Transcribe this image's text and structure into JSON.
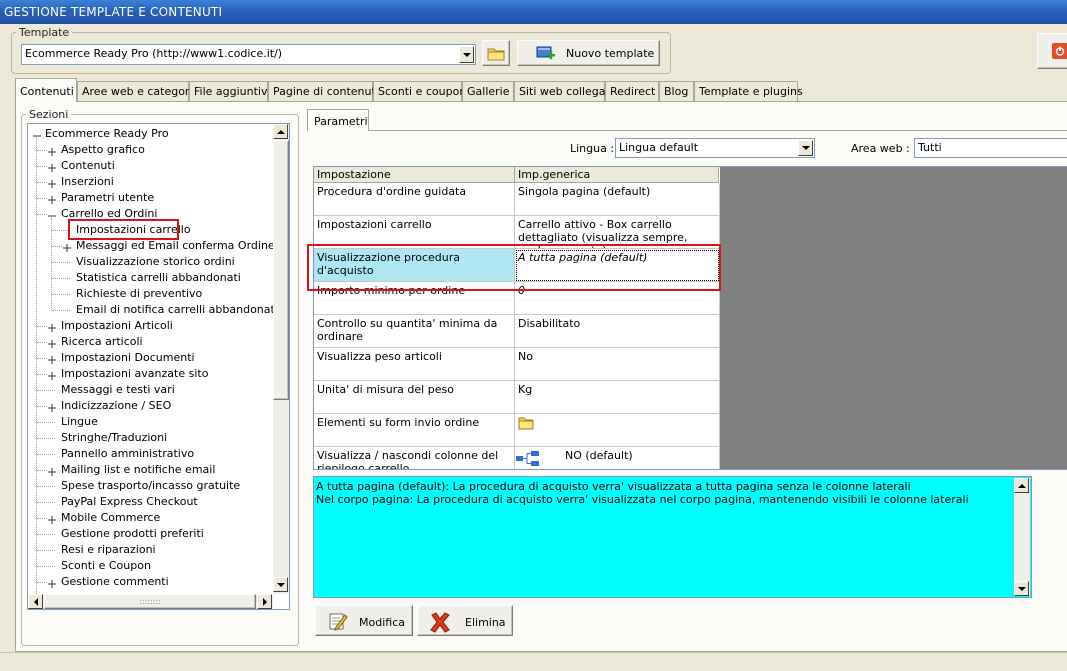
{
  "window": {
    "title": "GESTIONE TEMPLATE E CONTENUTI"
  },
  "template_group": {
    "legend": "Template",
    "selected": "Ecommerce Ready Pro (http://www1.codice.it/)",
    "new_template_label": "Nuovo template"
  },
  "tabs": [
    {
      "label": "Contenuti",
      "active": true
    },
    {
      "label": "Aree web e categorie"
    },
    {
      "label": "File aggiuntivi"
    },
    {
      "label": "Pagine di contenuti"
    },
    {
      "label": "Sconti e coupon"
    },
    {
      "label": "Gallerie"
    },
    {
      "label": "Siti web collegati"
    },
    {
      "label": "Redirect"
    },
    {
      "label": "Blog"
    },
    {
      "label": "Template e plugins"
    }
  ],
  "sections": {
    "legend": "Sezioni",
    "tree": [
      {
        "label": "Ecommerce Ready Pro",
        "level": 0,
        "expander": "minus"
      },
      {
        "label": "Aspetto grafico",
        "level": 1,
        "expander": "plus"
      },
      {
        "label": "Contenuti",
        "level": 1,
        "expander": "plus"
      },
      {
        "label": "Inserzioni",
        "level": 1,
        "expander": "plus"
      },
      {
        "label": "Parametri utente",
        "level": 1,
        "expander": "plus"
      },
      {
        "label": "Carrello ed Ordini",
        "level": 1,
        "expander": "minus"
      },
      {
        "label": "Impostazioni carrello",
        "level": 2,
        "expander": "none",
        "selected": true
      },
      {
        "label": "Messaggi ed Email conferma Ordine",
        "level": 2,
        "expander": "plus"
      },
      {
        "label": "Visualizzazione storico ordini",
        "level": 2,
        "expander": "none"
      },
      {
        "label": "Statistica carrelli abbandonati",
        "level": 2,
        "expander": "none"
      },
      {
        "label": "Richieste di preventivo",
        "level": 2,
        "expander": "none"
      },
      {
        "label": "Email di notifica carrelli abbandonati",
        "level": 2,
        "expander": "none"
      },
      {
        "label": "Impostazioni Articoli",
        "level": 1,
        "expander": "plus"
      },
      {
        "label": "Ricerca articoli",
        "level": 1,
        "expander": "plus"
      },
      {
        "label": "Impostazioni Documenti",
        "level": 1,
        "expander": "plus"
      },
      {
        "label": "Impostazioni avanzate sito",
        "level": 1,
        "expander": "plus"
      },
      {
        "label": "Messaggi e testi vari",
        "level": 1,
        "expander": "none"
      },
      {
        "label": "Indicizzazione / SEO",
        "level": 1,
        "expander": "plus"
      },
      {
        "label": "Lingue",
        "level": 1,
        "expander": "none"
      },
      {
        "label": "Stringhe/Traduzioni",
        "level": 1,
        "expander": "none"
      },
      {
        "label": "Pannello amministrativo",
        "level": 1,
        "expander": "none"
      },
      {
        "label": "Mailing list e notifiche email",
        "level": 1,
        "expander": "plus"
      },
      {
        "label": "Spese trasporto/incasso gratuite",
        "level": 1,
        "expander": "none"
      },
      {
        "label": "PayPal Express Checkout",
        "level": 1,
        "expander": "none"
      },
      {
        "label": "Mobile Commerce",
        "level": 1,
        "expander": "plus"
      },
      {
        "label": "Gestione prodotti preferiti",
        "level": 1,
        "expander": "none"
      },
      {
        "label": "Resi e riparazioni",
        "level": 1,
        "expander": "none"
      },
      {
        "label": "Sconti e Coupon",
        "level": 1,
        "expander": "none"
      },
      {
        "label": "Gestione commenti",
        "level": 1,
        "expander": "plus"
      }
    ],
    "hscroll_grip": "::::::::"
  },
  "parametri": {
    "tab_label": "Parametri",
    "lingua_label": "Lingua :",
    "lingua_value": "Lingua default",
    "area_label": "Area web :",
    "area_value": "Tutti",
    "columns": [
      "Impostazione",
      "Imp.generica"
    ],
    "rows": [
      {
        "name": "Procedura d'ordine guidata",
        "value": "Singola pagina (default)"
      },
      {
        "name": "Impostazioni carrello",
        "value": "Carrello attivo - Box carrello dettagliato (visualizza sempre, anche se vuoto)"
      },
      {
        "name": "Visualizzazione procedura d'acquisto",
        "value": "A tutta pagina (default)",
        "selected": true
      },
      {
        "name": "Importo minimo per ordine",
        "value": "0"
      },
      {
        "name": "Controllo su quantita' minima da ordinare",
        "value": "Disabilitato"
      },
      {
        "name": "Visualizza peso articoli",
        "value": "No"
      },
      {
        "name": "Unita' di misura del peso",
        "value": "Kg"
      },
      {
        "name": "Elementi su form invio ordine",
        "value": "",
        "icon": "folder-icon"
      },
      {
        "name": "Visualizza / nascondi colonne del riepilogo carrello",
        "value": "NO (default)",
        "icon": "tree-structure-icon"
      }
    ],
    "description_lines": [
      "A tutta pagina (default): La procedura di acquisto verra' visualizzata a tutta pagina senza le colonne laterali",
      "Nel corpo pagina: La procedura di acquisto verra' visualizzata nel corpo pagina, mantenendo visibili le colonne laterali"
    ],
    "modifica_label": "Modifica",
    "elimina_label": "Elimina"
  },
  "colors": {
    "titlebar": "#2a5fb8",
    "highlight_cyan": "#00ffff",
    "description_bg": "#00ffff",
    "grid_gray_area": "#808080",
    "annotation_red": "#d8141a"
  }
}
